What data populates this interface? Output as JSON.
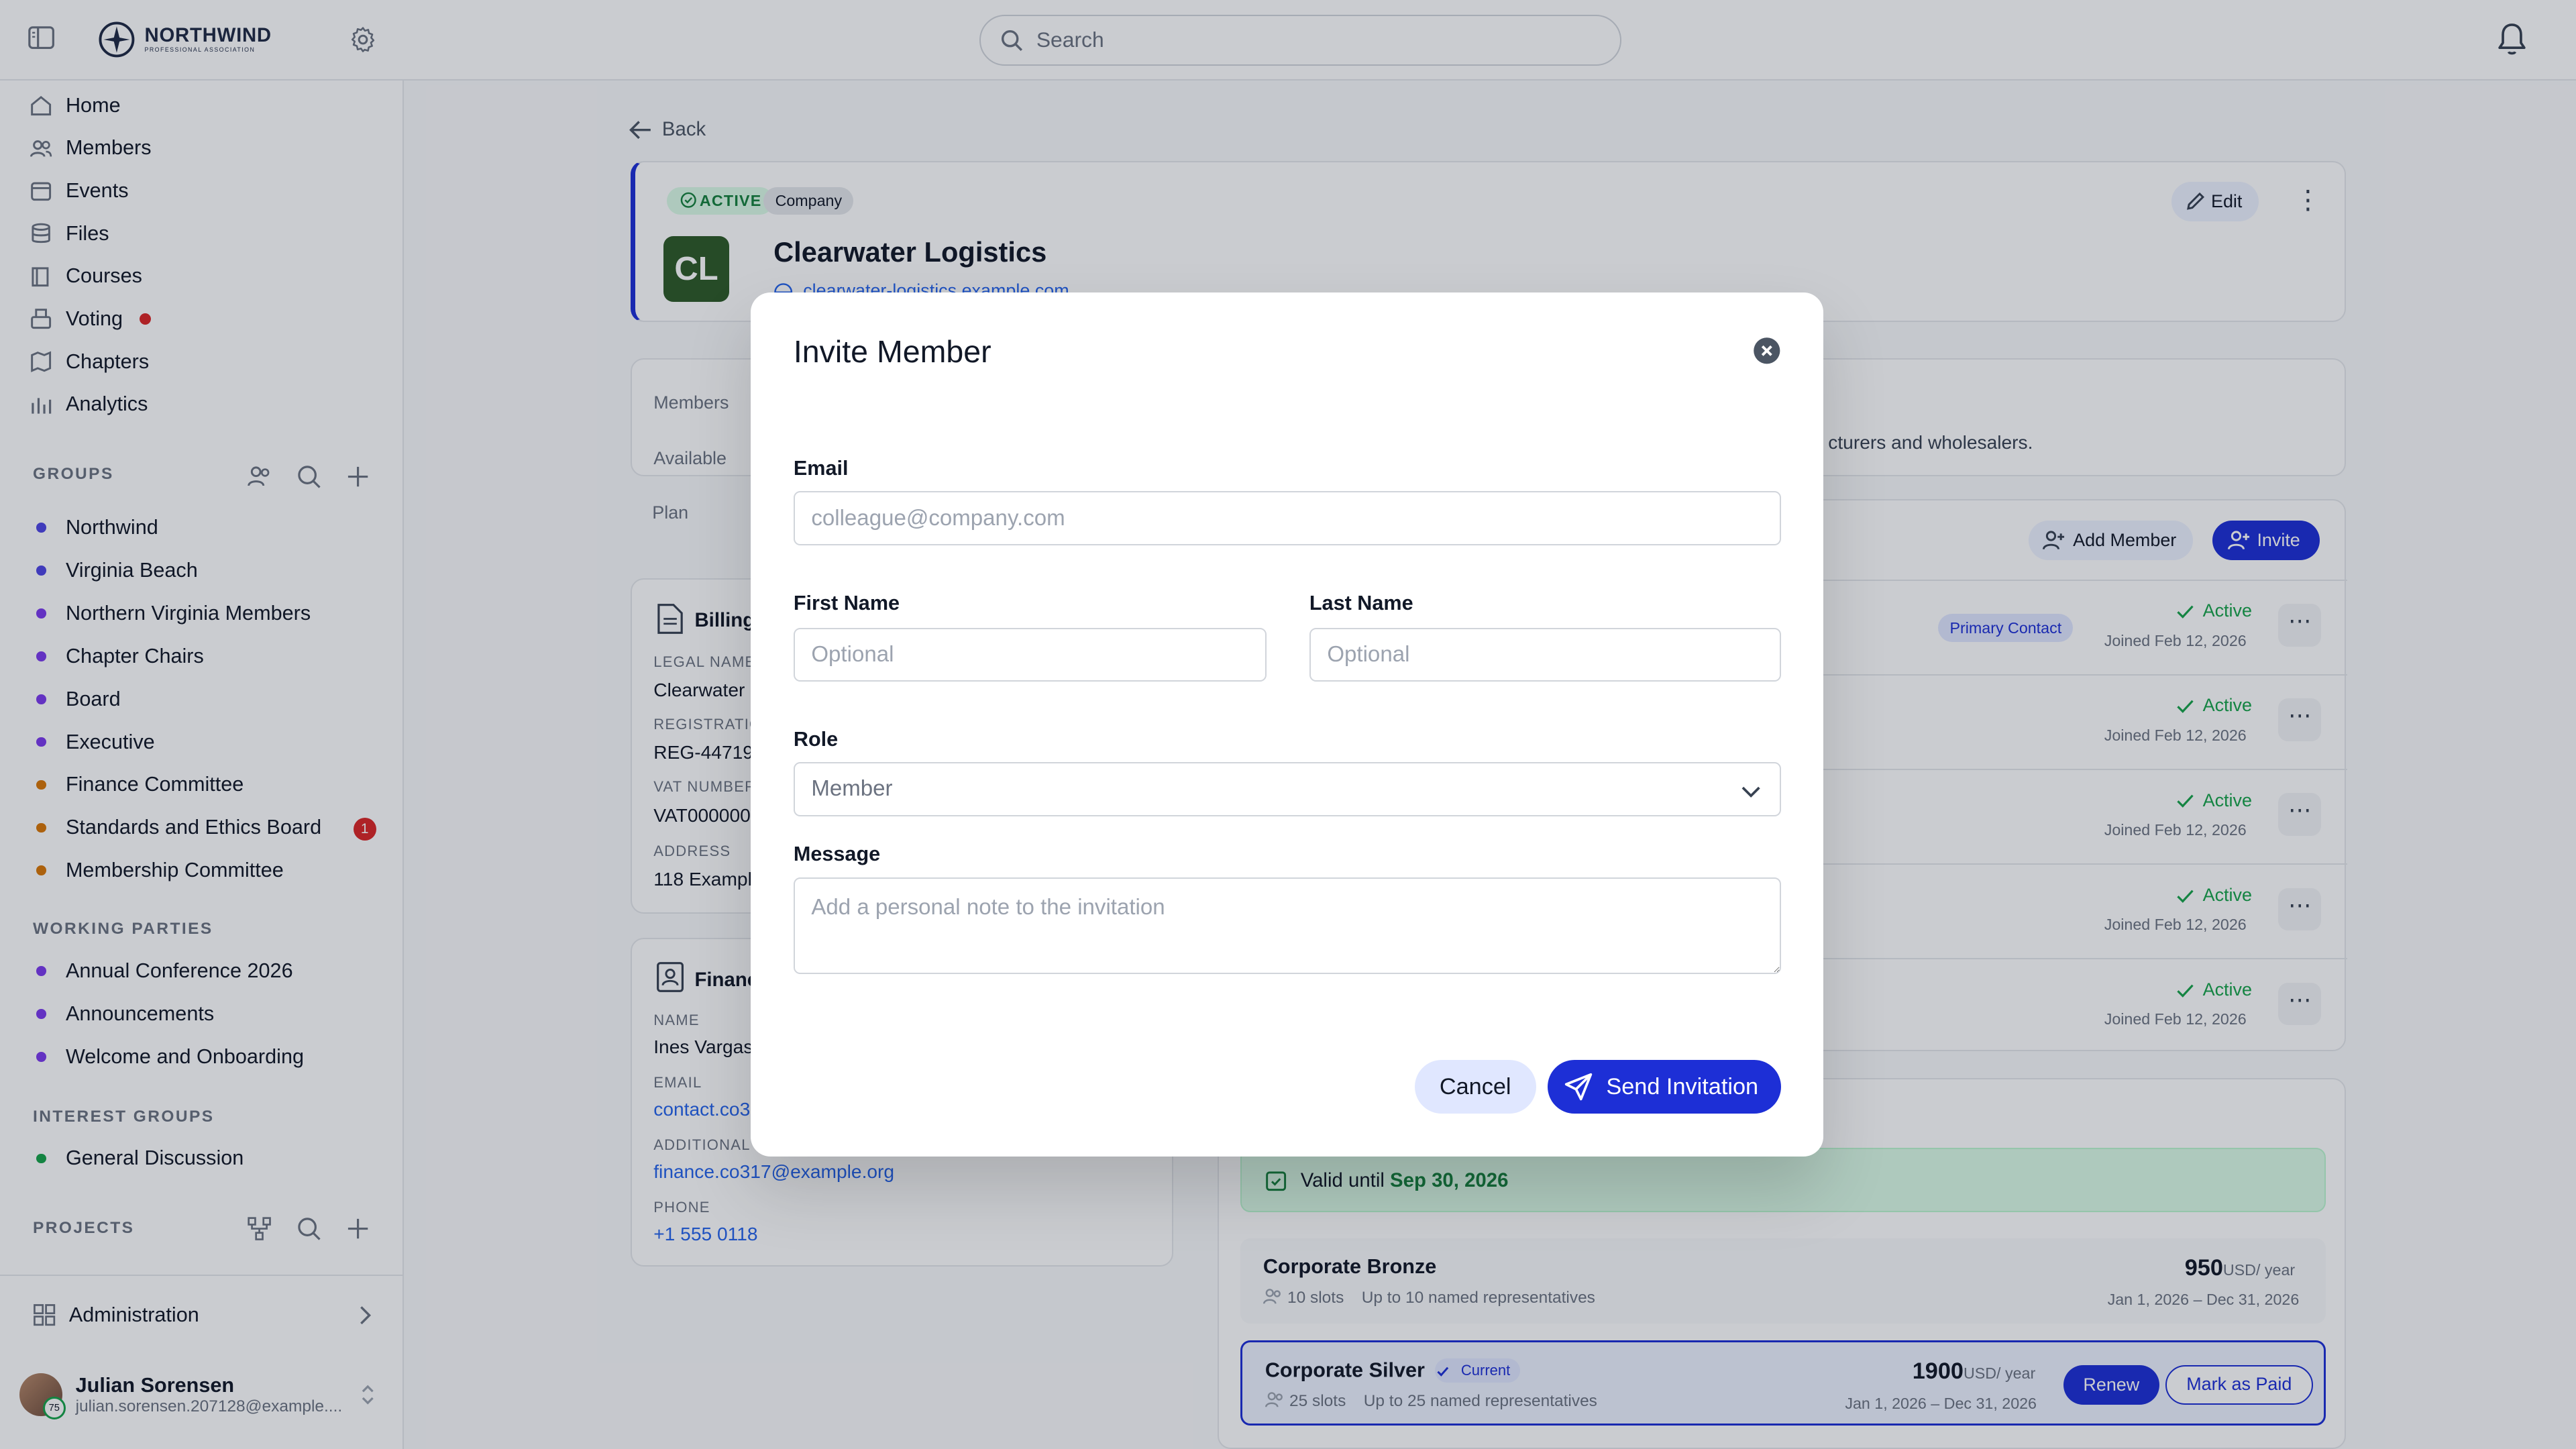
{
  "topbar": {
    "brand_name": "NORTHWIND",
    "brand_sub": "PROFESSIONAL ASSOCIATION",
    "search_placeholder": "Search"
  },
  "sidebar": {
    "nav": [
      {
        "label": "Home",
        "icon": "home-icon"
      },
      {
        "label": "Members",
        "icon": "users-icon"
      },
      {
        "label": "Events",
        "icon": "calendar-icon"
      },
      {
        "label": "Files",
        "icon": "database-icon"
      },
      {
        "label": "Courses",
        "icon": "book-icon"
      },
      {
        "label": "Voting",
        "icon": "ballot-icon"
      },
      {
        "label": "Chapters",
        "icon": "map-icon"
      },
      {
        "label": "Analytics",
        "icon": "chart-icon"
      }
    ],
    "groups_label": "GROUPS",
    "groups": [
      {
        "label": "Northwind",
        "color": "#4f46e5"
      },
      {
        "label": "Virginia Beach",
        "color": "#4f46e5"
      },
      {
        "label": "Northern Virginia Members",
        "color": "#7c3aed"
      },
      {
        "label": "Chapter Chairs",
        "color": "#7c3aed"
      },
      {
        "label": "Board",
        "color": "#7c3aed"
      },
      {
        "label": "Executive",
        "color": "#7c3aed"
      },
      {
        "label": "Finance Committee",
        "color": "#d97706"
      },
      {
        "label": "Standards and Ethics Board",
        "color": "#d97706",
        "badge": "1"
      },
      {
        "label": "Membership Committee",
        "color": "#d97706"
      }
    ],
    "working_parties_label": "WORKING PARTIES",
    "working_parties": [
      {
        "label": "Annual Conference 2026",
        "color": "#7c3aed"
      },
      {
        "label": "Announcements",
        "color": "#7c3aed"
      },
      {
        "label": "Welcome and Onboarding",
        "color": "#7c3aed"
      }
    ],
    "interest_groups_label": "INTEREST GROUPS",
    "interest_groups": [
      {
        "label": "General Discussion",
        "color": "#16a34a"
      }
    ],
    "projects_label": "PROJECTS",
    "admin_label": "Administration",
    "user": {
      "name": "Julian Sorensen",
      "email": "julian.sorensen.207128@example....",
      "badge": "75"
    }
  },
  "page": {
    "back_label": "Back",
    "status_pill": "ACTIVE",
    "type_pill": "Company",
    "avatar_initials": "CL",
    "company_name": "Clearwater Logistics",
    "company_url": "clearwater-logistics.example.com",
    "edit_label": "Edit",
    "summary": {
      "members_label": "Members",
      "available_label": "Available",
      "plan_label": "Plan",
      "description_fragment": "cturers and wholesalers."
    },
    "billing": {
      "title": "Billing",
      "legal_name_label": "LEGAL NAME",
      "legal_name": "Clearwater",
      "registration_label": "REGISTRATION",
      "registration": "REG-44719",
      "vat_label": "VAT NUMBER",
      "vat": "VAT000000",
      "address_label": "ADDRESS",
      "address": "118 Example"
    },
    "finance": {
      "title": "Financ",
      "name_label": "NAME",
      "name": "Ines Vargas",
      "email_label": "EMAIL",
      "email": "contact.co3",
      "additional_label": "ADDITIONAL",
      "additional": "finance.co317@example.org",
      "phone_label": "PHONE",
      "phone": "+1 555 0118"
    },
    "members": {
      "add_member_label": "Add Member",
      "invite_label": "Invite",
      "primary_contact_label": "Primary Contact",
      "rows": [
        {
          "status": "Active",
          "joined": "Joined Feb 12, 2026"
        },
        {
          "status": "Active",
          "joined": "Joined Feb 12, 2026"
        },
        {
          "status": "Active",
          "joined": "Joined Feb 12, 2026"
        },
        {
          "status": "Active",
          "joined": "Joined Feb 12, 2026"
        },
        {
          "status": "Active",
          "joined": "Joined Feb 12, 2026"
        }
      ]
    },
    "plans": {
      "valid_prefix": "Valid until ",
      "valid_date": "Sep 30, 2026",
      "list": [
        {
          "name": "Corporate Bronze",
          "slots": "10 slots",
          "desc": "Up to 10 named representatives",
          "price": "950",
          "currency": "USD",
          "period": "/ year",
          "dates": "Jan 1, 2026 – Dec 31, 2026"
        },
        {
          "name": "Corporate Silver",
          "current_label": "Current",
          "slots": "25 slots",
          "desc": "Up to 25 named representatives",
          "price": "1900",
          "currency": "USD",
          "period": "/ year",
          "dates": "Jan 1, 2026 – Dec 31, 2026",
          "renew_label": "Renew",
          "mark_paid_label": "Mark as Paid"
        }
      ]
    }
  },
  "modal": {
    "title": "Invite Member",
    "email_label": "Email",
    "email_placeholder": "colleague@company.com",
    "first_name_label": "First Name",
    "first_name_placeholder": "Optional",
    "last_name_label": "Last Name",
    "last_name_placeholder": "Optional",
    "role_label": "Role",
    "role_value": "Member",
    "message_label": "Message",
    "message_placeholder": "Add a personal note to the invitation",
    "cancel_label": "Cancel",
    "send_label": "Send Invitation"
  },
  "colors": {
    "accent": "#1d2fd6",
    "success": "#16a34a",
    "danger": "#dc2626"
  }
}
